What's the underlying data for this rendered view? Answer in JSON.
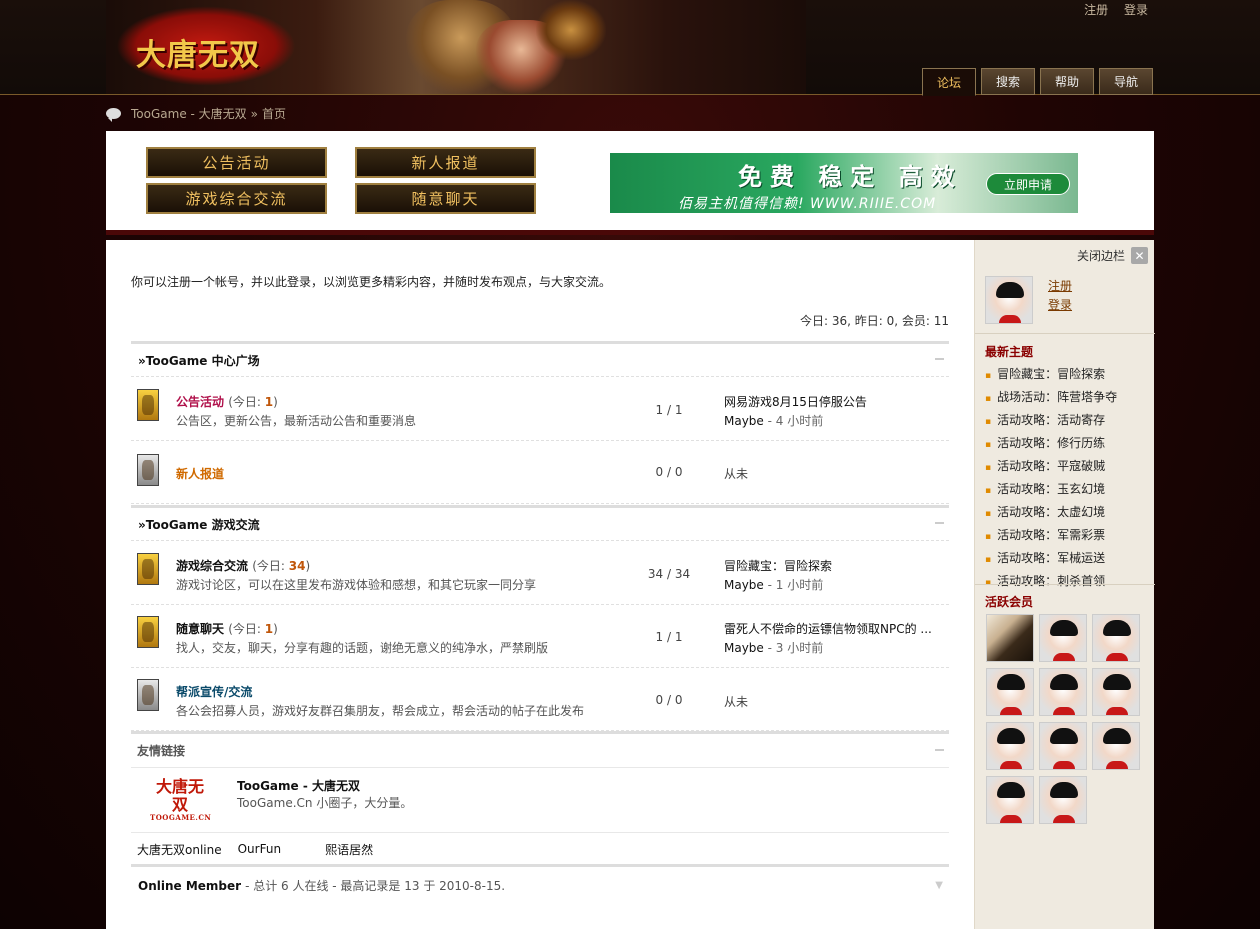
{
  "header": {
    "logo_text": "大唐无双",
    "top_links": [
      "注册",
      "登录"
    ],
    "tabs": [
      {
        "label": "论坛",
        "active": true
      },
      {
        "label": "搜索"
      },
      {
        "label": "帮助"
      },
      {
        "label": "导航"
      }
    ]
  },
  "breadcrumb": {
    "site": "TooGame - 大唐无双",
    "sep": "»",
    "current": "首页"
  },
  "quick_nav": [
    "公告活动",
    "新人报道",
    "游戏综合交流",
    "随意聊天"
  ],
  "ad": {
    "line1": "免费 稳定 高效",
    "line2": "佰易主机值得信赖! WWW.RIIIE.COM",
    "button": "立即申请"
  },
  "intro": "你可以注册一个帐号，并以此登录，以浏览更多精彩内容，并随时发布观点，与大家交流。",
  "stats": "今日: 36, 昨日: 0, 会员: 11",
  "sections": [
    {
      "title": "»TooGame 中心广场",
      "forums": [
        {
          "name": "公告活动",
          "name_color": "#b0104a",
          "today_prefix": "(今日: ",
          "today": "1",
          "today_suffix": ")",
          "desc": "公告区，更新公告，最新活动公告和重要消息",
          "count": "1 / 1",
          "last_title": "网易游戏8月15日停服公告",
          "last_user": "Maybe",
          "last_time": "- 4 小时前",
          "icon": "new"
        },
        {
          "name": "新人报道",
          "name_color": "#d06a00",
          "count": "0 / 0",
          "last_title": "从未",
          "icon": "old"
        }
      ]
    },
    {
      "title": "»TooGame 游戏交流",
      "forums": [
        {
          "name": "游戏综合交流",
          "name_color": "#111111",
          "today_prefix": "(今日: ",
          "today": "34",
          "today_suffix": ")",
          "desc": "游戏讨论区，可以在这里发布游戏体验和感想，和其它玩家一同分享",
          "count": "34 / 34",
          "last_title": "冒险藏宝：冒险探索",
          "last_user": "Maybe",
          "last_time": "- 1 小时前",
          "icon": "new"
        },
        {
          "name": "随意聊天",
          "name_color": "#111111",
          "today_prefix": "(今日: ",
          "today": "1",
          "today_suffix": ")",
          "desc": "找人，交友，聊天，分享有趣的话题，谢绝无意义的纯净水，严禁刷版",
          "count": "1 / 1",
          "last_title": "雷死人不偿命的运镖信物领取NPC的 ...",
          "last_user": "Maybe",
          "last_time": "- 3 小时前",
          "icon": "new"
        },
        {
          "name": "帮派宣传/交流",
          "name_color": "#0a4a6a",
          "desc": "各公会招募人员，游戏好友群召集朋友，帮会成立，帮会活动的帖子在此发布",
          "count": "0 / 0",
          "last_title": "从未",
          "icon": "old"
        }
      ]
    }
  ],
  "friend_links": {
    "title": "友情链接",
    "logo_text": "大唐无双",
    "logo_sub": "TOOGAME.CN",
    "featured_title": "TooGame - 大唐无双",
    "featured_desc": "TooGame.Cn 小圈子，大分量。",
    "text_links": [
      "大唐无双online",
      "OurFun",
      "熙语居然"
    ]
  },
  "online": {
    "label": "Online Member",
    "text": "- 总计 6 人在线 - 最高记录是 13 于 2010-8-15."
  },
  "sidebar": {
    "close_label": "关闭边栏",
    "user_links": [
      "注册",
      "登录"
    ],
    "latest_title": "最新主题",
    "latest_threads": [
      "冒险藏宝：冒险探索",
      "战场活动：阵营塔争夺",
      "活动攻略：活动寄存",
      "活动攻略：修行历练",
      "活动攻略：平寇破贼",
      "活动攻略：玉玄幻境",
      "活动攻略：太虚幻境",
      "活动攻略：军需彩票",
      "活动攻略：军械运送",
      "活动攻略：刺杀首领"
    ],
    "active_title": "活跃会员",
    "active_members": [
      "photo",
      "default",
      "default",
      "default",
      "default",
      "default",
      "default",
      "default",
      "default",
      "default",
      "default"
    ]
  },
  "colors": {
    "accent": "#f0c060",
    "forum_highlight": "#c0560a",
    "sidebar_title": "#8a0000"
  }
}
